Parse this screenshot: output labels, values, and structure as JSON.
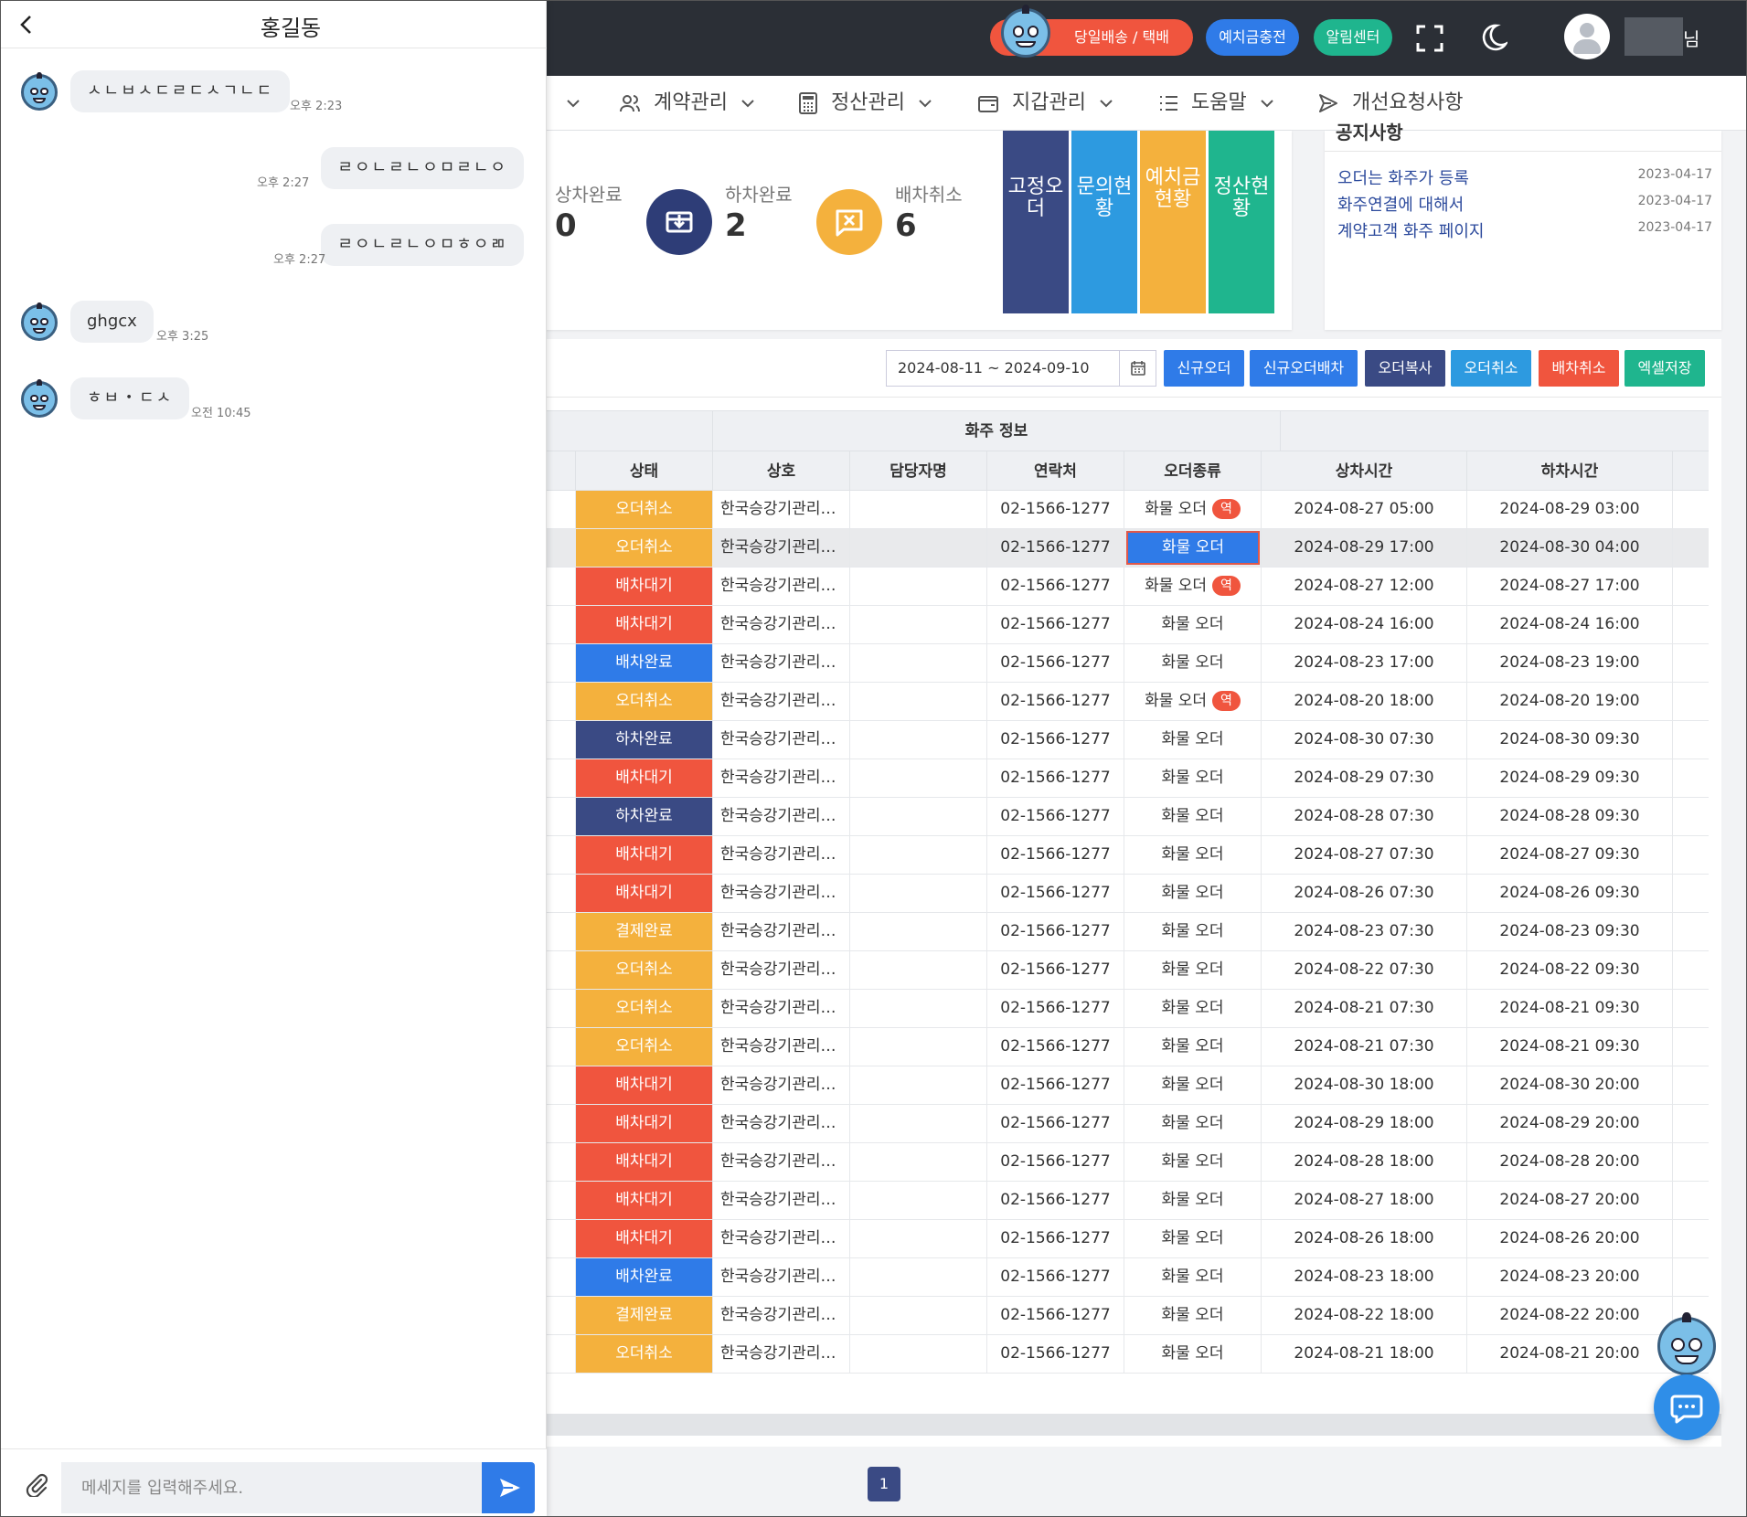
{
  "topbar": {
    "delivery_label": "당일배송 / 택배",
    "deposit_label": "예치금충전",
    "alarm_label": "알림센터",
    "user_suffix": "님"
  },
  "nav": {
    "items": [
      {
        "label": "계약관리",
        "icon": "users-icon"
      },
      {
        "label": "정산관리",
        "icon": "calculator-icon"
      },
      {
        "label": "지갑관리",
        "icon": "wallet-icon"
      },
      {
        "label": "도움말",
        "icon": "list-icon"
      },
      {
        "label": "개선요청사항",
        "icon": "send-icon"
      }
    ]
  },
  "stats": {
    "loaded": {
      "label": "상차완료",
      "value": "0"
    },
    "unloaded": {
      "label": "하차완료",
      "value": "2"
    },
    "cancelled": {
      "label": "배차취소",
      "value": "6"
    },
    "colors": {
      "unloaded": "#2e3d77",
      "cancelled": "#f4b13d"
    }
  },
  "quick_tiles": [
    {
      "label": "고정오더",
      "color": "#3a4a84"
    },
    {
      "label": "문의현황",
      "color": "#2d9ae0"
    },
    {
      "label": "예치금현황",
      "color": "#f4b13d"
    },
    {
      "label": "정산현황",
      "color": "#1fb58e"
    }
  ],
  "notice": {
    "title": "공지사항",
    "items": [
      {
        "title": "오더는 화주가 등록",
        "date": "2023-04-17"
      },
      {
        "title": "화주연결에 대해서",
        "date": "2023-04-17"
      },
      {
        "title": "계약고객 화주 페이지",
        "date": "2023-04-17"
      }
    ]
  },
  "toolbar": {
    "date_range": "2024-08-11 ~ 2024-09-10",
    "buttons": [
      {
        "label": "신규오더",
        "color": "#2f7be8"
      },
      {
        "label": "신규오더배차",
        "color": "#2f7be8"
      },
      {
        "label": "오더복사",
        "color": "#3a4a84"
      },
      {
        "label": "오더취소",
        "color": "#2d9ae0"
      },
      {
        "label": "배차취소",
        "color": "#f0553e"
      },
      {
        "label": "엑셀저장",
        "color": "#1fb58e"
      }
    ]
  },
  "table": {
    "group_label": "화주 정보",
    "columns": [
      "상태",
      "상호",
      "담당자명",
      "연락처",
      "오더종류",
      "상차시간",
      "하차시간"
    ],
    "reverse_badge": "역",
    "status_colors": {
      "오더취소": "#f4b13d",
      "배차대기": "#f0553e",
      "배차완료": "#2f7be8",
      "하차완료": "#3a4a84",
      "결제완료": "#f4b13d"
    },
    "rows": [
      {
        "status": "오더취소",
        "company": "한국승강기관리…",
        "manager": "",
        "phone": "02-1566-1277",
        "order_type": "화물 오더",
        "reverse": true,
        "load": "2024-08-27 05:00",
        "unload": "2024-08-29 03:00"
      },
      {
        "status": "오더취소",
        "company": "한국승강기관리…",
        "manager": "",
        "phone": "02-1566-1277",
        "order_type": "화물 오더",
        "reverse": false,
        "selected": true,
        "load": "2024-08-29 17:00",
        "unload": "2024-08-30 04:00"
      },
      {
        "status": "배차대기",
        "company": "한국승강기관리…",
        "manager": "",
        "phone": "02-1566-1277",
        "order_type": "화물 오더",
        "reverse": true,
        "load": "2024-08-27 12:00",
        "unload": "2024-08-27 17:00"
      },
      {
        "status": "배차대기",
        "company": "한국승강기관리…",
        "manager": "",
        "phone": "02-1566-1277",
        "order_type": "화물 오더",
        "reverse": false,
        "load": "2024-08-24 16:00",
        "unload": "2024-08-24 16:00"
      },
      {
        "status": "배차완료",
        "company": "한국승강기관리…",
        "manager": "",
        "phone": "02-1566-1277",
        "order_type": "화물 오더",
        "reverse": false,
        "load": "2024-08-23 17:00",
        "unload": "2024-08-23 19:00"
      },
      {
        "status": "오더취소",
        "company": "한국승강기관리…",
        "manager": "",
        "phone": "02-1566-1277",
        "order_type": "화물 오더",
        "reverse": true,
        "load": "2024-08-20 18:00",
        "unload": "2024-08-20 19:00"
      },
      {
        "status": "하차완료",
        "company": "한국승강기관리…",
        "manager": "",
        "phone": "02-1566-1277",
        "order_type": "화물 오더",
        "reverse": false,
        "load": "2024-08-30 07:30",
        "unload": "2024-08-30 09:30"
      },
      {
        "status": "배차대기",
        "company": "한국승강기관리…",
        "manager": "",
        "phone": "02-1566-1277",
        "order_type": "화물 오더",
        "reverse": false,
        "load": "2024-08-29 07:30",
        "unload": "2024-08-29 09:30"
      },
      {
        "status": "하차완료",
        "company": "한국승강기관리…",
        "manager": "",
        "phone": "02-1566-1277",
        "order_type": "화물 오더",
        "reverse": false,
        "load": "2024-08-28 07:30",
        "unload": "2024-08-28 09:30"
      },
      {
        "status": "배차대기",
        "company": "한국승강기관리…",
        "manager": "",
        "phone": "02-1566-1277",
        "order_type": "화물 오더",
        "reverse": false,
        "load": "2024-08-27 07:30",
        "unload": "2024-08-27 09:30"
      },
      {
        "status": "배차대기",
        "company": "한국승강기관리…",
        "manager": "",
        "phone": "02-1566-1277",
        "order_type": "화물 오더",
        "reverse": false,
        "load": "2024-08-26 07:30",
        "unload": "2024-08-26 09:30"
      },
      {
        "status": "결제완료",
        "company": "한국승강기관리…",
        "manager": "",
        "phone": "02-1566-1277",
        "order_type": "화물 오더",
        "reverse": false,
        "load": "2024-08-23 07:30",
        "unload": "2024-08-23 09:30"
      },
      {
        "status": "오더취소",
        "company": "한국승강기관리…",
        "manager": "",
        "phone": "02-1566-1277",
        "order_type": "화물 오더",
        "reverse": false,
        "load": "2024-08-22 07:30",
        "unload": "2024-08-22 09:30"
      },
      {
        "status": "오더취소",
        "company": "한국승강기관리…",
        "manager": "",
        "phone": "02-1566-1277",
        "order_type": "화물 오더",
        "reverse": false,
        "load": "2024-08-21 07:30",
        "unload": "2024-08-21 09:30"
      },
      {
        "status": "오더취소",
        "company": "한국승강기관리…",
        "manager": "",
        "phone": "02-1566-1277",
        "order_type": "화물 오더",
        "reverse": false,
        "load": "2024-08-21 07:30",
        "unload": "2024-08-21 09:30"
      },
      {
        "status": "배차대기",
        "company": "한국승강기관리…",
        "manager": "",
        "phone": "02-1566-1277",
        "order_type": "화물 오더",
        "reverse": false,
        "load": "2024-08-30 18:00",
        "unload": "2024-08-30 20:00"
      },
      {
        "status": "배차대기",
        "company": "한국승강기관리…",
        "manager": "",
        "phone": "02-1566-1277",
        "order_type": "화물 오더",
        "reverse": false,
        "load": "2024-08-29 18:00",
        "unload": "2024-08-29 20:00"
      },
      {
        "status": "배차대기",
        "company": "한국승강기관리…",
        "manager": "",
        "phone": "02-1566-1277",
        "order_type": "화물 오더",
        "reverse": false,
        "load": "2024-08-28 18:00",
        "unload": "2024-08-28 20:00"
      },
      {
        "status": "배차대기",
        "company": "한국승강기관리…",
        "manager": "",
        "phone": "02-1566-1277",
        "order_type": "화물 오더",
        "reverse": false,
        "load": "2024-08-27 18:00",
        "unload": "2024-08-27 20:00"
      },
      {
        "status": "배차대기",
        "company": "한국승강기관리…",
        "manager": "",
        "phone": "02-1566-1277",
        "order_type": "화물 오더",
        "reverse": false,
        "load": "2024-08-26 18:00",
        "unload": "2024-08-26 20:00"
      },
      {
        "status": "배차완료",
        "company": "한국승강기관리…",
        "manager": "",
        "phone": "02-1566-1277",
        "order_type": "화물 오더",
        "reverse": false,
        "load": "2024-08-23 18:00",
        "unload": "2024-08-23 20:00"
      },
      {
        "status": "결제완료",
        "company": "한국승강기관리…",
        "manager": "",
        "phone": "02-1566-1277",
        "order_type": "화물 오더",
        "reverse": false,
        "load": "2024-08-22 18:00",
        "unload": "2024-08-22 20:00"
      },
      {
        "status": "오더취소",
        "company": "한국승강기관리…",
        "manager": "",
        "phone": "02-1566-1277",
        "order_type": "화물 오더",
        "reverse": false,
        "load": "2024-08-21 18:00",
        "unload": "2024-08-21 20:00"
      }
    ]
  },
  "pagination": {
    "current": "1"
  },
  "chat": {
    "title": "홍길동",
    "input_placeholder": "메세지를 입력해주세요.",
    "messages": [
      {
        "side": "left",
        "text": "ㅅㄴㅂㅅㄷㄹㄷㅅㄱㄴㄷ",
        "time": "오후 2:23"
      },
      {
        "side": "right",
        "text": "ㄹㅇㄴㄹㄴㅇㅁㄹㄴㅇ",
        "time": "오후 2:27"
      },
      {
        "side": "right",
        "text": "ㄹㅇㄴㄹㄴㅇㅁㅎㅇㄻ",
        "time": "오후 2:27"
      },
      {
        "side": "left",
        "text": "ghgcx",
        "time": "오후 3:25"
      },
      {
        "side": "left",
        "text": "ㅎㅂ・ㄷㅅ",
        "time": "오전 10:45"
      }
    ]
  }
}
